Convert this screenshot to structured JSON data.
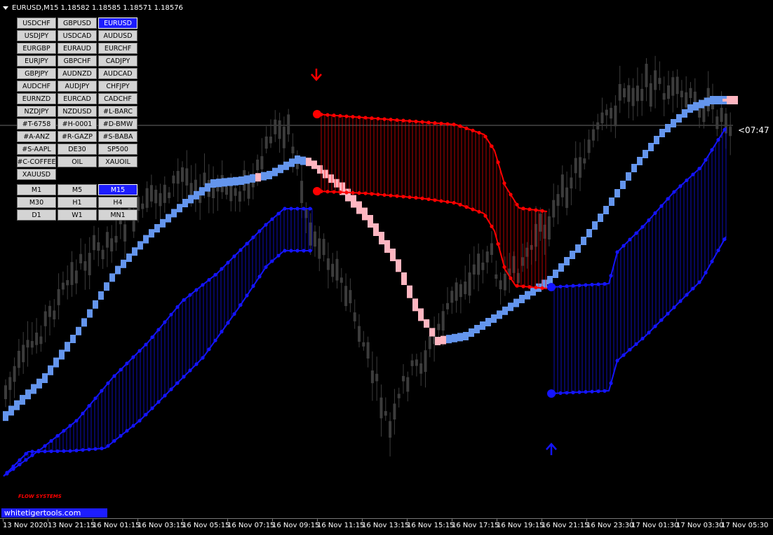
{
  "header": {
    "symbol": "EURUSD,M15",
    "open": "1.18582",
    "high": "1.18585",
    "low": "1.18571",
    "close": "1.18576"
  },
  "symbol_buttons": [
    {
      "label": "USDCHF",
      "active": false
    },
    {
      "label": "GBPUSD",
      "active": false
    },
    {
      "label": "EURUSD",
      "active": true
    },
    {
      "label": "USDJPY",
      "active": false
    },
    {
      "label": "USDCAD",
      "active": false
    },
    {
      "label": "AUDUSD",
      "active": false
    },
    {
      "label": "EURGBP",
      "active": false
    },
    {
      "label": "EURAUD",
      "active": false
    },
    {
      "label": "EURCHF",
      "active": false
    },
    {
      "label": "EURJPY",
      "active": false
    },
    {
      "label": "GBPCHF",
      "active": false
    },
    {
      "label": "CADJPY",
      "active": false
    },
    {
      "label": "GBPJPY",
      "active": false
    },
    {
      "label": "AUDNZD",
      "active": false
    },
    {
      "label": "AUDCAD",
      "active": false
    },
    {
      "label": "AUDCHF",
      "active": false
    },
    {
      "label": "AUDJPY",
      "active": false
    },
    {
      "label": "CHFJPY",
      "active": false
    },
    {
      "label": "EURNZD",
      "active": false
    },
    {
      "label": "EURCAD",
      "active": false
    },
    {
      "label": "CADCHF",
      "active": false
    },
    {
      "label": "NZDJPY",
      "active": false
    },
    {
      "label": "NZDUSD",
      "active": false
    },
    {
      "label": "#L-BARC",
      "active": false
    },
    {
      "label": "#T-6758",
      "active": false
    },
    {
      "label": "#H-0001",
      "active": false
    },
    {
      "label": "#D-BMW",
      "active": false
    },
    {
      "label": "#A-ANZ",
      "active": false
    },
    {
      "label": "#R-GAZP",
      "active": false
    },
    {
      "label": "#S-BABA",
      "active": false
    },
    {
      "label": "#S-AAPL",
      "active": false
    },
    {
      "label": "DE30",
      "active": false
    },
    {
      "label": "SP500",
      "active": false
    },
    {
      "label": "#C-COFFEE",
      "active": false
    },
    {
      "label": "OIL",
      "active": false
    },
    {
      "label": "XAUOIL",
      "active": false
    },
    {
      "label": "XAUUSD",
      "active": false
    }
  ],
  "timeframe_buttons": [
    {
      "label": "M1",
      "active": false
    },
    {
      "label": "M5",
      "active": false
    },
    {
      "label": "M15",
      "active": true
    },
    {
      "label": "M30",
      "active": false
    },
    {
      "label": "H1",
      "active": false
    },
    {
      "label": "H4",
      "active": false
    },
    {
      "label": "D1",
      "active": false
    },
    {
      "label": "W1",
      "active": false
    },
    {
      "label": "MN1",
      "active": false
    }
  ],
  "countdown": "<07:47",
  "brand": "whitetigertools.com",
  "flow_label": "FLOW SYSTEMS",
  "time_axis": [
    "13 Nov 2020",
    "13 Nov 21:15",
    "16 Nov 01:15",
    "16 Nov 03:15",
    "16 Nov 05:15",
    "16 Nov 07:15",
    "16 Nov 09:15",
    "16 Nov 11:15",
    "16 Nov 13:15",
    "16 Nov 15:15",
    "16 Nov 17:15",
    "16 Nov 19:15",
    "16 Nov 21:15",
    "16 Nov 23:30",
    "17 Nov 01:30",
    "17 Nov 03:30",
    "17 Nov 05:30"
  ],
  "colors": {
    "background": "#000000",
    "candle": "#3c3c3c",
    "trend_up": "#6495ed",
    "trend_down": "#ffb6c1",
    "sell_band": "#ff0000",
    "buy_band": "#1414ff",
    "button_active": "#1d1dff"
  },
  "signals": [
    {
      "type": "sell-arrow",
      "color": "#ff0000"
    },
    {
      "type": "buy-arrow",
      "color": "#1414ff"
    }
  ]
}
